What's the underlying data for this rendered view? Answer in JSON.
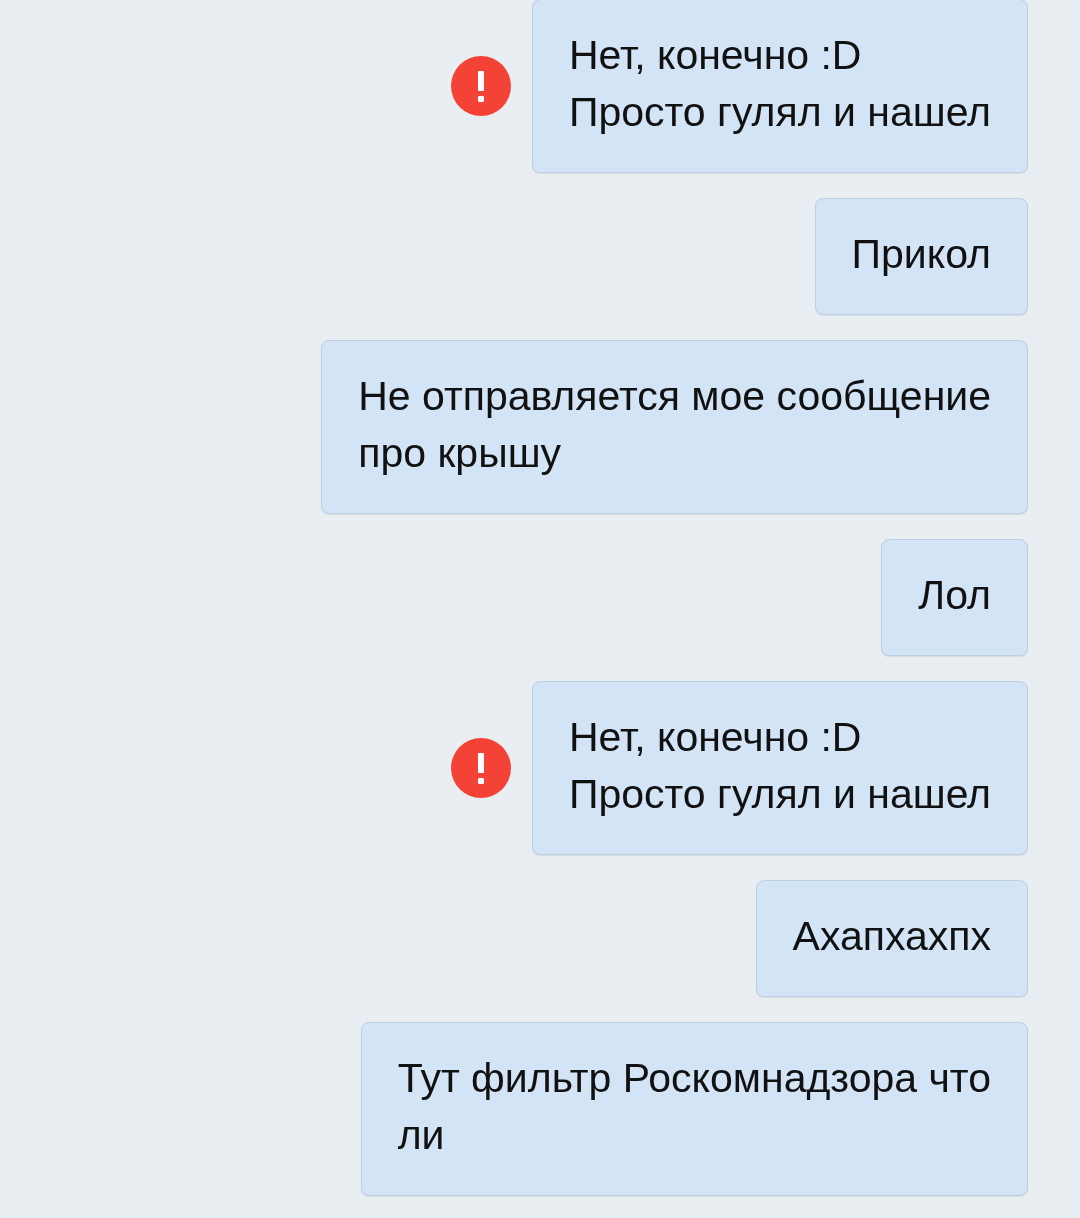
{
  "messages": [
    {
      "text": "Нет, конечно :D\nПросто гулял и нашел",
      "failed": true
    },
    {
      "text": "Прикол",
      "failed": false
    },
    {
      "text": "Не отправляется мое сообщение\nпро крышу",
      "failed": false
    },
    {
      "text": "Лол",
      "failed": false
    },
    {
      "text": "Нет, конечно :D\nПросто гулял и нашел",
      "failed": true
    },
    {
      "text": "Ахапхахпх",
      "failed": false
    },
    {
      "text": "Тут фильтр Роскомнадзора что\nли",
      "failed": false
    }
  ]
}
